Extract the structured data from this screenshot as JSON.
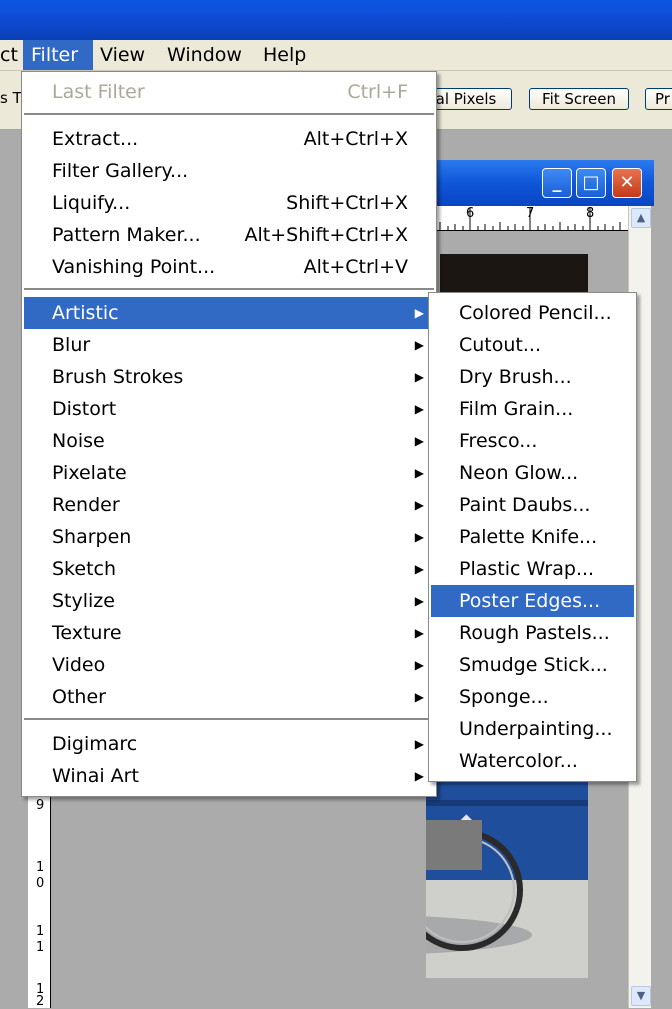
{
  "menubar": {
    "items": [
      {
        "label": "ct",
        "active": false
      },
      {
        "label": "Filter",
        "active": true
      },
      {
        "label": "View",
        "active": false
      },
      {
        "label": "Window",
        "active": false
      },
      {
        "label": "Help",
        "active": false
      }
    ]
  },
  "options_bar": {
    "left_fragment": "s T",
    "actual_pixels_label": "al Pixels",
    "fit_screen_label": "Fit Screen",
    "print_size_label": "Pr"
  },
  "filter_menu": {
    "last_filter": {
      "label": "Last Filter",
      "shortcut": "Ctrl+F"
    },
    "group1": [
      {
        "label": "Extract...",
        "shortcut": "Alt+Ctrl+X"
      },
      {
        "label": "Filter Gallery...",
        "shortcut": ""
      },
      {
        "label": "Liquify...",
        "shortcut": "Shift+Ctrl+X"
      },
      {
        "label": "Pattern Maker...",
        "shortcut": "Alt+Shift+Ctrl+X"
      },
      {
        "label": "Vanishing Point...",
        "shortcut": "Alt+Ctrl+V"
      }
    ],
    "categories": [
      {
        "label": "Artistic"
      },
      {
        "label": "Blur"
      },
      {
        "label": "Brush Strokes"
      },
      {
        "label": "Distort"
      },
      {
        "label": "Noise"
      },
      {
        "label": "Pixelate"
      },
      {
        "label": "Render"
      },
      {
        "label": "Sharpen"
      },
      {
        "label": "Sketch"
      },
      {
        "label": "Stylize"
      },
      {
        "label": "Texture"
      },
      {
        "label": "Video"
      },
      {
        "label": "Other"
      }
    ],
    "plugins": [
      {
        "label": "Digimarc"
      },
      {
        "label": "Winai Art"
      }
    ],
    "highlighted": "Artistic"
  },
  "artistic_submenu": {
    "items": [
      {
        "label": "Colored Pencil..."
      },
      {
        "label": "Cutout..."
      },
      {
        "label": "Dry Brush..."
      },
      {
        "label": "Film Grain..."
      },
      {
        "label": "Fresco..."
      },
      {
        "label": "Neon Glow..."
      },
      {
        "label": "Paint Daubs..."
      },
      {
        "label": "Palette Knife..."
      },
      {
        "label": "Plastic Wrap..."
      },
      {
        "label": "Poster Edges..."
      },
      {
        "label": "Rough Pastels..."
      },
      {
        "label": "Smudge Stick..."
      },
      {
        "label": "Sponge..."
      },
      {
        "label": "Underpainting..."
      },
      {
        "label": "Watercolor..."
      }
    ],
    "highlighted": "Poster Edges..."
  },
  "document": {
    "window_buttons": {
      "minimize": "_",
      "maximize": "□",
      "close": "✕"
    },
    "ruler_top_numbers": [
      "6",
      "7",
      "8"
    ],
    "ruler_left_numbers": [
      "9",
      "1",
      "0",
      "1",
      "1",
      "1",
      "2"
    ]
  },
  "icons": {
    "submenu_arrow": "submenu-arrow-icon",
    "scroll_up": "scroll-up-icon",
    "scroll_down": "scroll-down-icon"
  },
  "colors": {
    "highlight": "#316ac5",
    "menu_bg": "#ffffff",
    "xp_titlebar": "#0a4cd6",
    "chrome": "#ece9d8"
  }
}
